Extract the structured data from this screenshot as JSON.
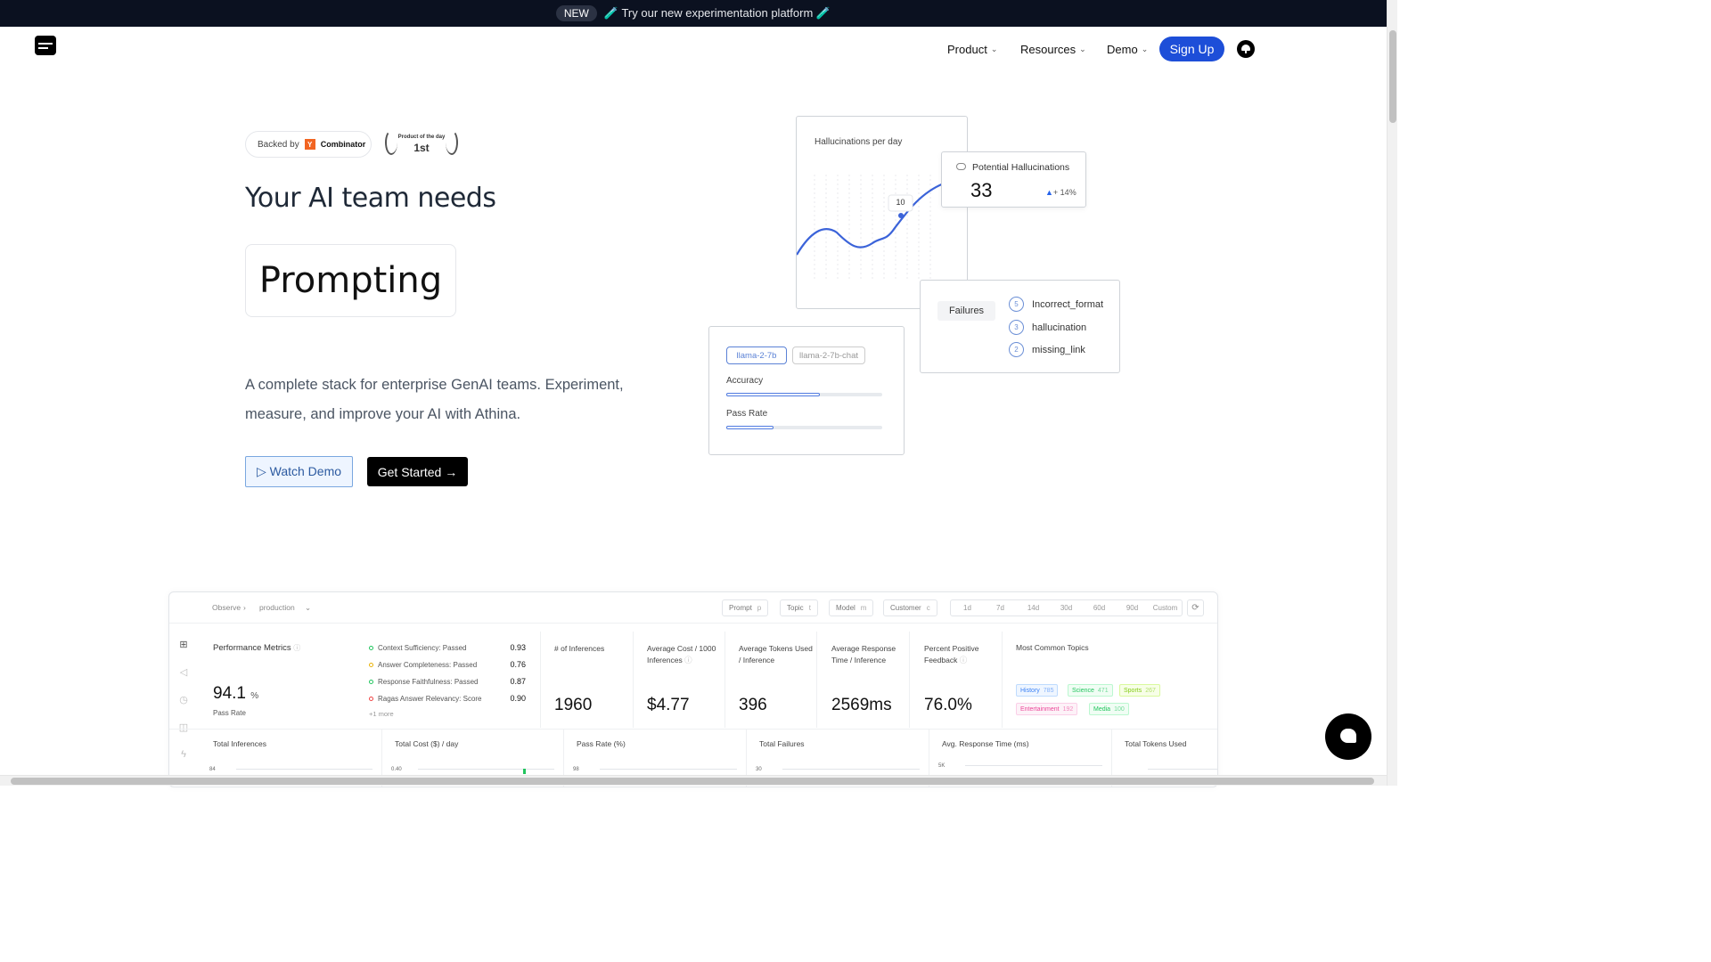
{
  "banner": {
    "badge": "NEW",
    "text": "🧪 Try our new experimentation platform 🧪"
  },
  "nav": {
    "items": [
      {
        "label": "Product"
      },
      {
        "label": "Resources"
      },
      {
        "label": "Demo"
      }
    ],
    "signup": "Sign Up"
  },
  "hero": {
    "backed_by": "Backed by",
    "yc_logo": "Y",
    "yc_name": "Combinator",
    "pod_line1": "Product of the day",
    "pod_line2": "1st",
    "title": "Your AI team needs",
    "rotating_word": "Prompting",
    "description": "A complete stack for enterprise GenAI teams. Experiment, measure, and improve your AI with Athina.",
    "watch_demo": "▷ Watch Demo",
    "get_started": "Get Started →"
  },
  "illustration": {
    "hallucinations_title": "Hallucinations per day",
    "point_label": "10",
    "potential_title": "Potential Hallucinations",
    "potential_value": "33",
    "potential_change": "+ 14%",
    "failures_label": "Failures",
    "failures": [
      {
        "count": "5",
        "name": "Incorrect_format"
      },
      {
        "count": "3",
        "name": "hallucination"
      },
      {
        "count": "2",
        "name": "missing_link"
      }
    ],
    "models": [
      "llama-2-7b",
      "llama-2-7b-chat"
    ],
    "metrics": [
      {
        "label": "Accuracy",
        "fill": 0.6
      },
      {
        "label": "Pass Rate",
        "fill": 0.3
      }
    ]
  },
  "dashboard": {
    "breadcrumb": [
      "Observe",
      "production"
    ],
    "filters": [
      {
        "label": "Prompt",
        "key": "p"
      },
      {
        "label": "Topic",
        "key": "t"
      },
      {
        "label": "Model",
        "key": "m"
      },
      {
        "label": "Customer",
        "key": "c"
      }
    ],
    "ranges": [
      "1d",
      "7d",
      "14d",
      "30d",
      "60d",
      "90d",
      "Custom"
    ],
    "performance": {
      "title": "Performance Metrics",
      "value": "94.1",
      "unit": "%",
      "sub": "Pass Rate"
    },
    "evals": [
      {
        "label": "Context Sufficiency: Passed",
        "value": "0.93",
        "color": "#22c55e"
      },
      {
        "label": "Answer Completeness: Passed",
        "value": "0.76",
        "color": "#eab308"
      },
      {
        "label": "Response Faithfulness: Passed",
        "value": "0.87",
        "color": "#22c55e"
      },
      {
        "label": "Ragas Answer Relevancy: Score",
        "value": "0.90",
        "color": "#ef4444"
      }
    ],
    "evals_more": "+1 more",
    "kpis": [
      {
        "label": "# of Inferences",
        "value": "1960"
      },
      {
        "label": "Average Cost / 1000 Inferences",
        "value": "$4.77"
      },
      {
        "label": "Average Tokens Used / Inference",
        "value": "396"
      },
      {
        "label": "Average Response Time / Inference",
        "value": "2569ms"
      },
      {
        "label": "Percent Positive Feedback",
        "value": "76.0%"
      }
    ],
    "topics_title": "Most Common Topics",
    "topics": [
      {
        "name": "History",
        "count": "785",
        "color": "#3b82f6"
      },
      {
        "name": "Science",
        "count": "471",
        "color": "#22c55e"
      },
      {
        "name": "Sports",
        "count": "267",
        "color": "#84cc16"
      },
      {
        "name": "Entertainment",
        "count": "192",
        "color": "#ec4899"
      },
      {
        "name": "Media",
        "count": "100",
        "color": "#22c55e"
      }
    ],
    "row2": [
      {
        "label": "Total Inferences",
        "tick": "84"
      },
      {
        "label": "Total Cost ($) / day",
        "tick": "0.40"
      },
      {
        "label": "Pass Rate (%)",
        "tick": "98"
      },
      {
        "label": "Total Failures",
        "tick": "30"
      },
      {
        "label": "Avg. Response Time (ms)",
        "tick": "5K"
      },
      {
        "label": "Total Tokens Used",
        "tick": ""
      }
    ]
  }
}
